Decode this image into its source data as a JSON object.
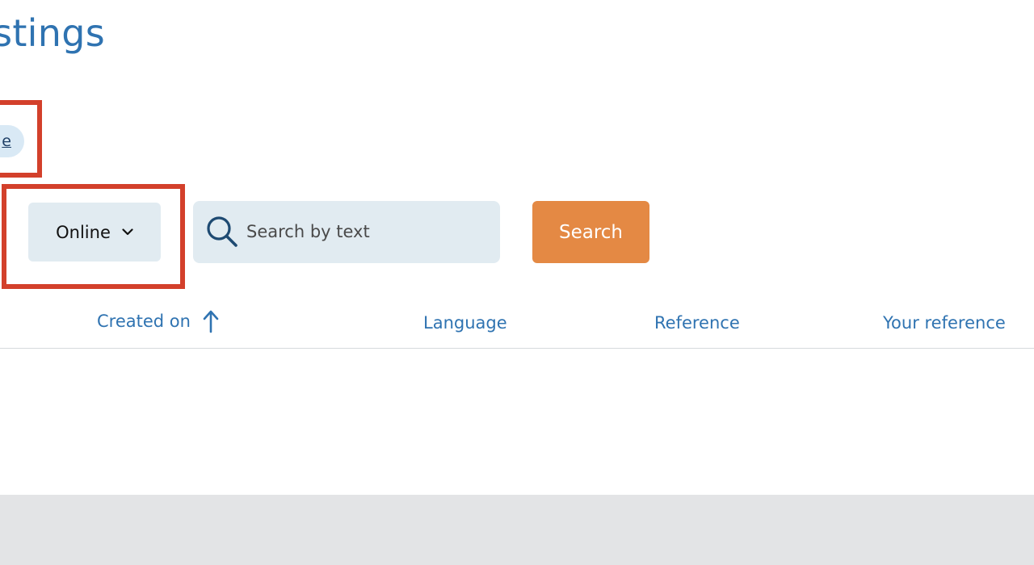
{
  "page": {
    "title": "istings"
  },
  "filter_chip": {
    "label": "e"
  },
  "filters": {
    "status_select": {
      "selected": "Online"
    },
    "search": {
      "placeholder": "Search by text",
      "value": "",
      "button_label": "Search"
    }
  },
  "table": {
    "columns": [
      {
        "label": "Created on",
        "sort": "ascending"
      },
      {
        "label": "Language"
      },
      {
        "label": "Reference"
      },
      {
        "label": "Your reference"
      }
    ]
  },
  "colors": {
    "accent": "#2f73b1",
    "search_button": "#e48944",
    "highlight": "#d3402b",
    "field_background": "#e1ebf1",
    "footer": "#e3e4e6"
  },
  "icons": {
    "select": "chevron-down-icon",
    "search": "search-icon",
    "sort": "arrow-up-icon"
  }
}
